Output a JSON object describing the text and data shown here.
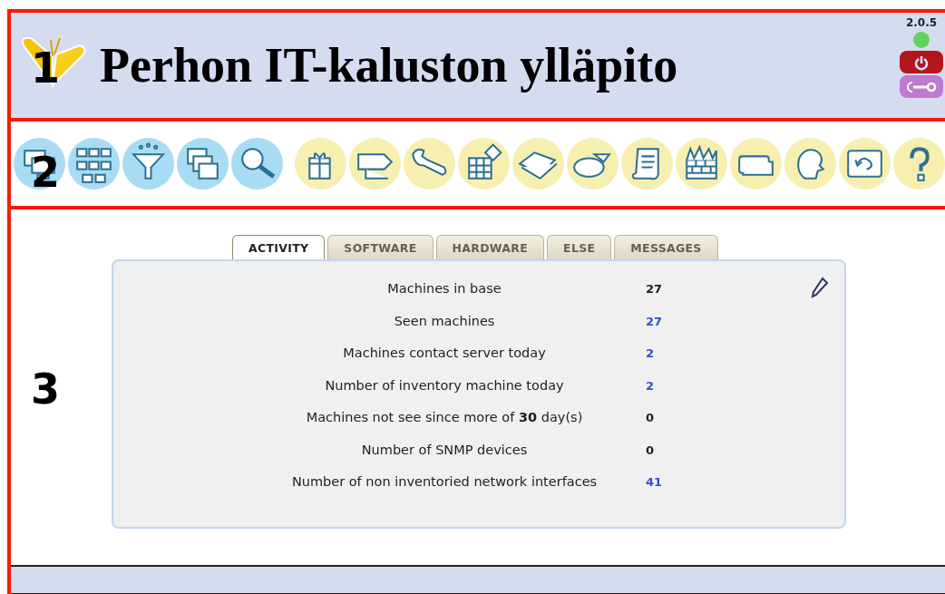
{
  "markers": [
    "1",
    "2",
    "3"
  ],
  "header": {
    "title": "Perhon IT-kaluston ylläpito",
    "version": "2.0.5"
  },
  "tabs": [
    {
      "label": "ACTIVITY",
      "selected": true
    },
    {
      "label": "SOFTWARE",
      "selected": false
    },
    {
      "label": "HARDWARE",
      "selected": false
    },
    {
      "label": "ELSE",
      "selected": false
    },
    {
      "label": "MESSAGES",
      "selected": false
    }
  ],
  "stats": [
    {
      "label": "Machines in base",
      "value": "27",
      "kind": "plain"
    },
    {
      "label": "Seen machines",
      "value": "27",
      "kind": "link"
    },
    {
      "label": "Machines contact server today",
      "value": "2",
      "kind": "link"
    },
    {
      "label": "Number of inventory machine today",
      "value": "2",
      "kind": "link"
    },
    {
      "label": "Machines not see since more of **30** day(s)",
      "value": "0",
      "kind": "plain"
    },
    {
      "label": "Number of SNMP devices",
      "value": "0",
      "kind": "plain"
    },
    {
      "label": "Number of non inventoried network interfaces",
      "value": "41",
      "kind": "link"
    }
  ]
}
